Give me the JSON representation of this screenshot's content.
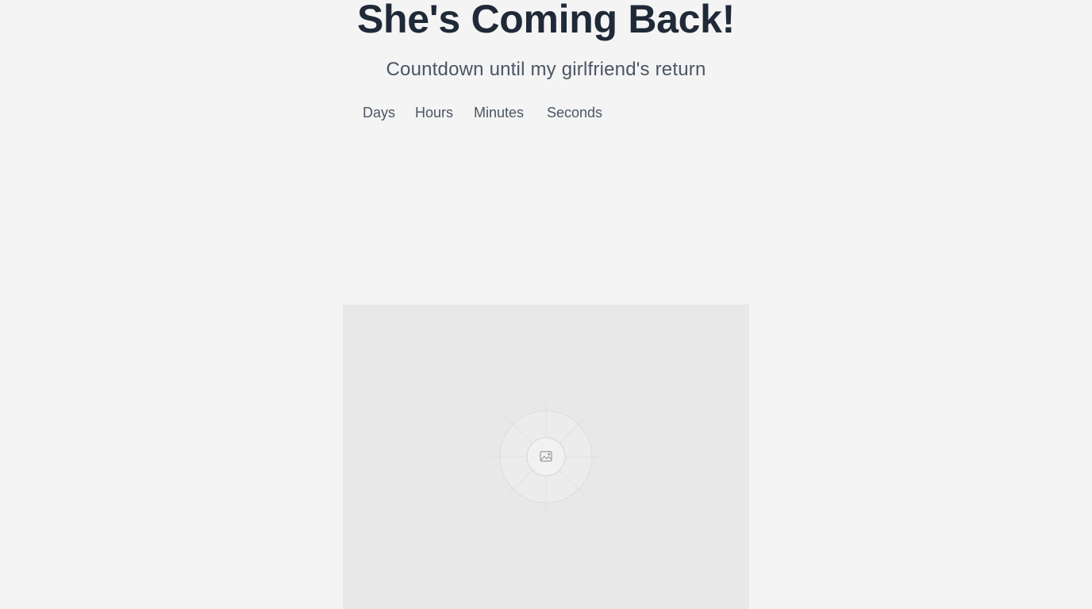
{
  "header": {
    "title": "She's Coming Back!",
    "subtitle": "Countdown until my girlfriend's return"
  },
  "countdown": {
    "units": [
      {
        "label": "Days"
      },
      {
        "label": "Hours"
      },
      {
        "label": "Minutes"
      },
      {
        "label": "Seconds"
      }
    ]
  },
  "image": {
    "icon": "image-icon",
    "background_color": "#e8e8e8"
  },
  "colors": {
    "page_background": "#f4f4f4",
    "title_text": "#1f2937",
    "body_text": "#4b5563"
  }
}
